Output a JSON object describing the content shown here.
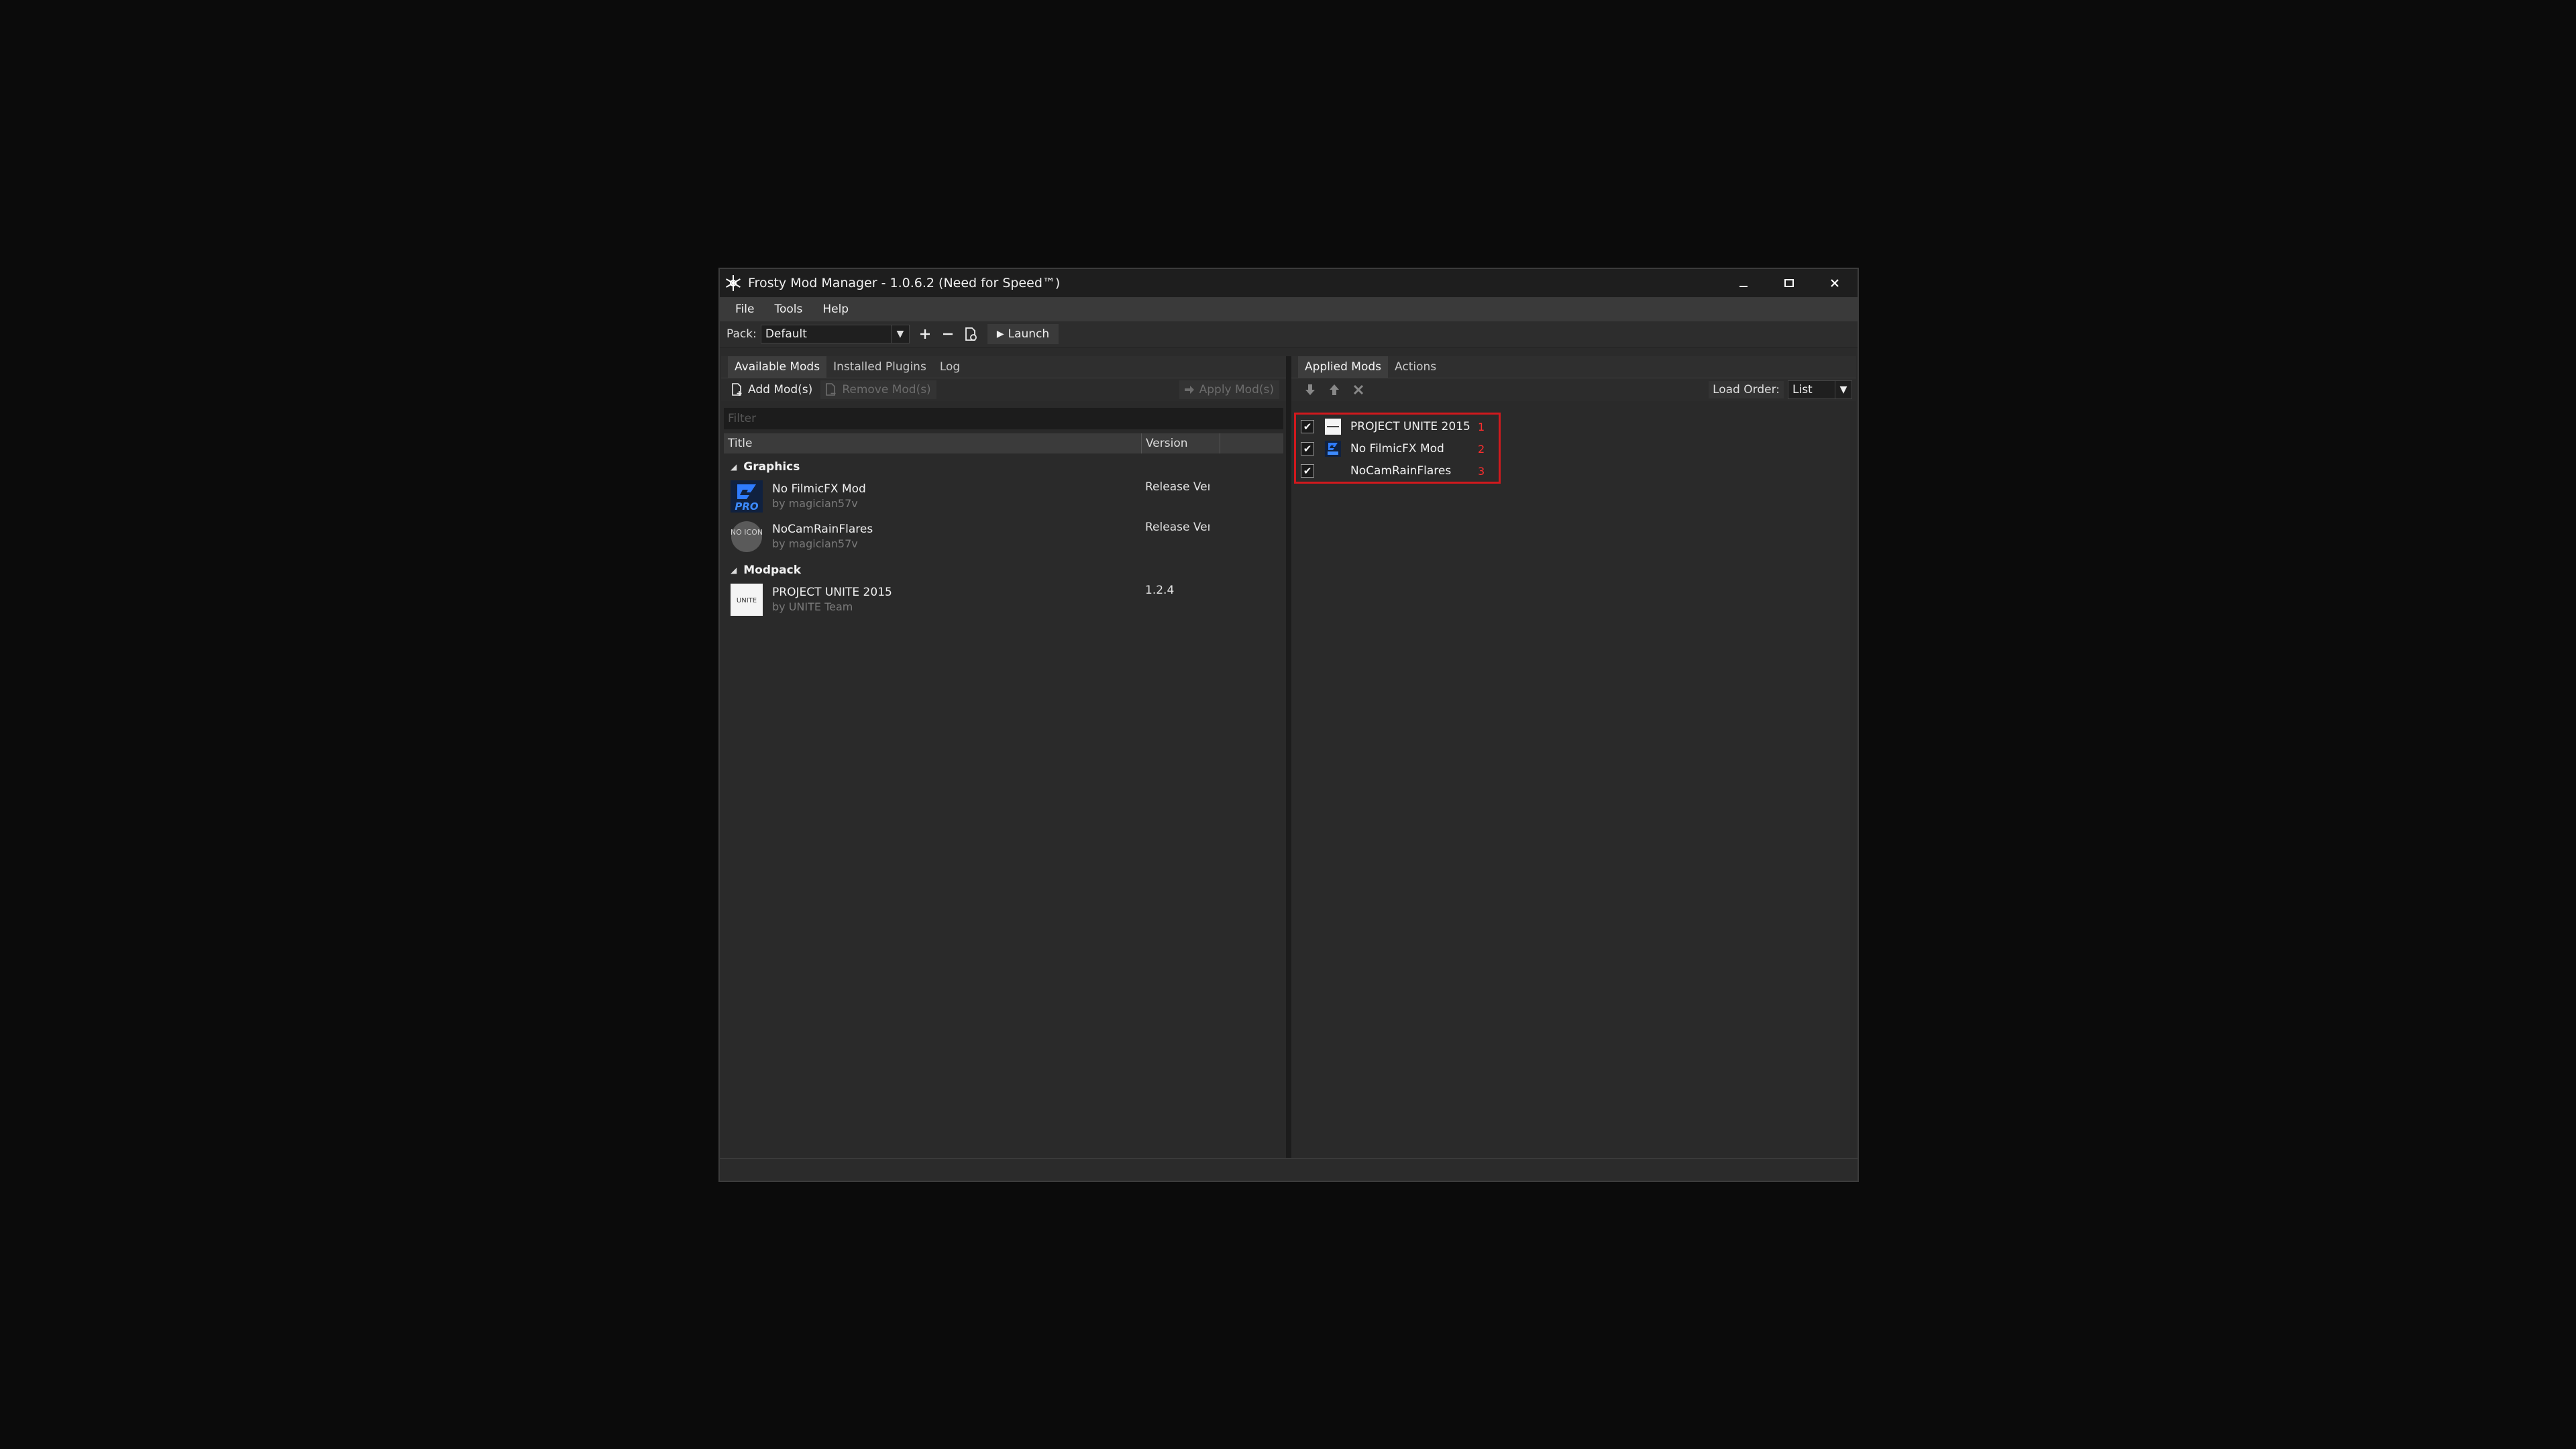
{
  "window": {
    "title": "Frosty Mod Manager - 1.0.6.2 (Need for Speed™)",
    "controls": [
      "minimize",
      "maximize",
      "close"
    ]
  },
  "menu": [
    "File",
    "Tools",
    "Help"
  ],
  "toolbar": {
    "pack_label": "Pack:",
    "pack_value": "Default",
    "launch_label": "Launch"
  },
  "left": {
    "tabs": [
      "Available Mods",
      "Installed Plugins",
      "Log"
    ],
    "actions": {
      "add": "Add Mod(s)",
      "remove": "Remove Mod(s)",
      "apply": "Apply Mod(s)"
    },
    "filter_placeholder": "Filter",
    "columns": {
      "title": "Title",
      "version": "Version"
    },
    "groups": [
      {
        "name": "Graphics",
        "mods": [
          {
            "name": "No FilmicFX Mod",
            "author": "by magician57v",
            "version": "Release Vers",
            "icon": "pro-icon"
          },
          {
            "name": "NoCamRainFlares",
            "author": "by magician57v",
            "version": "Release Vers",
            "icon": "no-icon-icon",
            "icon_text": "NO ICON"
          }
        ]
      },
      {
        "name": "Modpack",
        "mods": [
          {
            "name": "PROJECT UNITE 2015",
            "author": "by UNITE Team",
            "version": "1.2.4",
            "icon": "unite-logo-icon",
            "icon_text": "UNITE"
          }
        ]
      }
    ]
  },
  "right": {
    "tabs": [
      "Applied Mods",
      "Actions"
    ],
    "load_order_label": "Load Order:",
    "load_order_value": "List",
    "applied": [
      {
        "name": "PROJECT UNITE 2015",
        "order": "1",
        "checked": true,
        "icon": "unite-logo-icon"
      },
      {
        "name": "No FilmicFX Mod",
        "order": "2",
        "checked": true,
        "icon": "pro-icon"
      },
      {
        "name": "NoCamRainFlares",
        "order": "3",
        "checked": true,
        "icon": ""
      }
    ]
  },
  "colors": {
    "highlight_border": "#d1191d",
    "order_number": "#ff2e2e",
    "background": "#0b0b0b",
    "panel": "#2a2a2a"
  }
}
